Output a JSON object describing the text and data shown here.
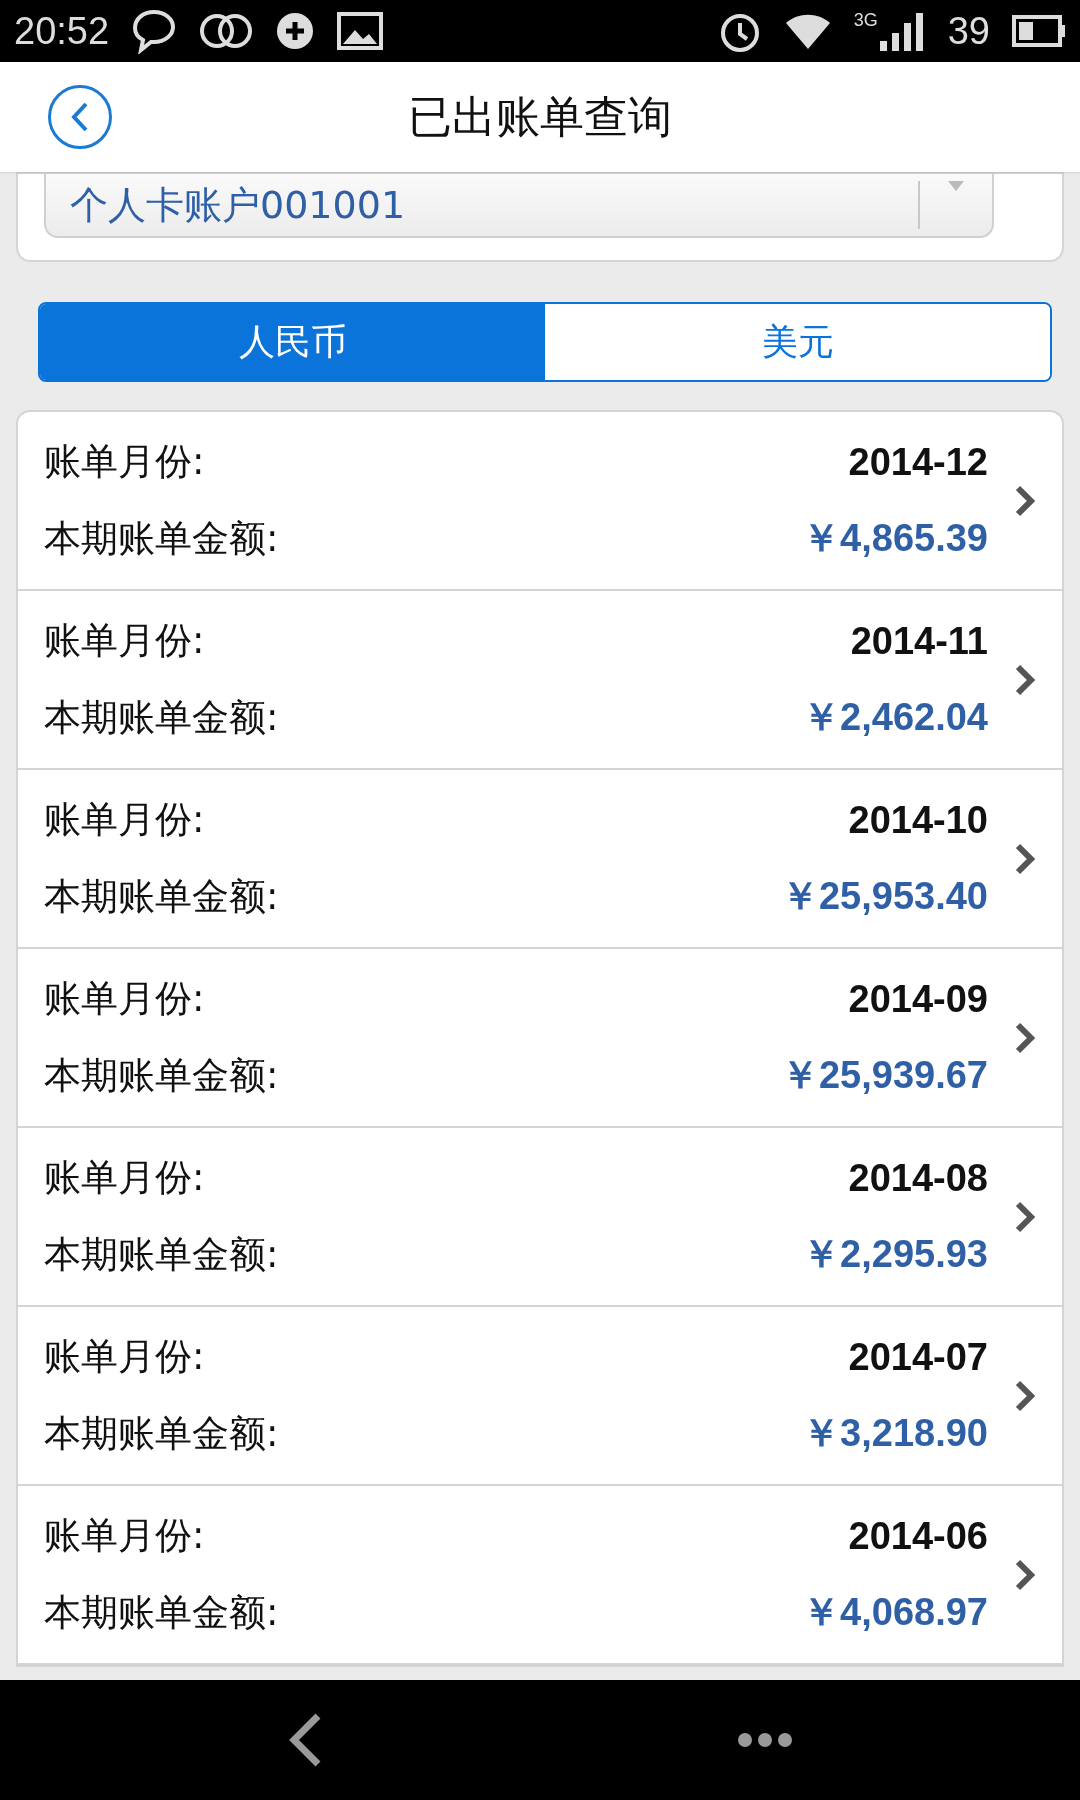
{
  "status_bar": {
    "time": "20:52",
    "signal_label": "3G",
    "battery": "39"
  },
  "header": {
    "title": "已出账单查询"
  },
  "account_select": {
    "value": "个人卡账户001001"
  },
  "tabs": [
    {
      "label": "人民币",
      "selected": true
    },
    {
      "label": "美元",
      "selected": false
    }
  ],
  "bills": [
    {
      "month_label": "账单月份:",
      "month": "2014-12",
      "amount_label": "本期账单金额:",
      "amount": "￥4,865.39"
    },
    {
      "month_label": "账单月份:",
      "month": "2014-11",
      "amount_label": "本期账单金额:",
      "amount": "￥2,462.04"
    },
    {
      "month_label": "账单月份:",
      "month": "2014-10",
      "amount_label": "本期账单金额:",
      "amount": "￥25,953.40"
    },
    {
      "month_label": "账单月份:",
      "month": "2014-09",
      "amount_label": "本期账单金额:",
      "amount": "￥25,939.67"
    },
    {
      "month_label": "账单月份:",
      "month": "2014-08",
      "amount_label": "本期账单金额:",
      "amount": "￥2,295.93"
    },
    {
      "month_label": "账单月份:",
      "month": "2014-07",
      "amount_label": "本期账单金额:",
      "amount": "￥3,218.90"
    },
    {
      "month_label": "账单月份:",
      "month": "2014-06",
      "amount_label": "本期账单金额:",
      "amount": "￥4,068.97"
    }
  ]
}
